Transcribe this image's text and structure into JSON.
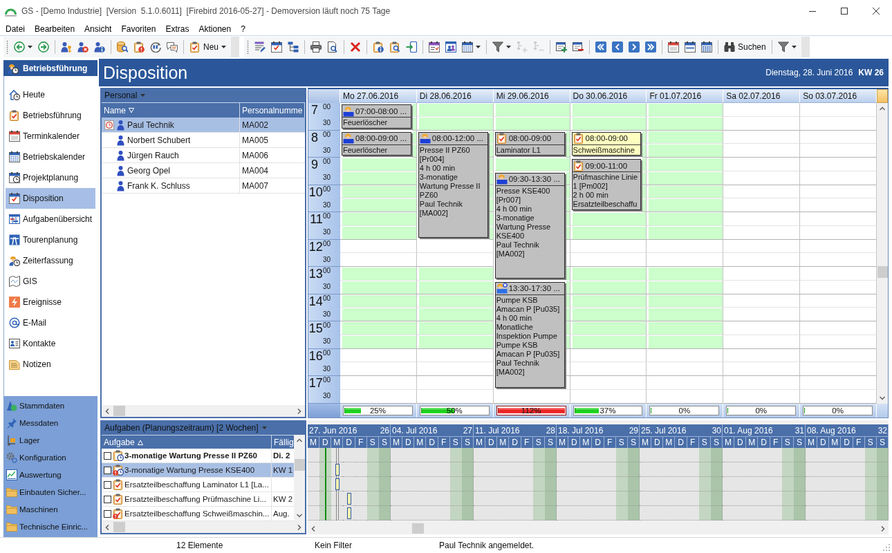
{
  "window": {
    "title": "GS - [Demo Industrie]  [Version  5.1.0.6011]  [Firebird 2016-05-27] - Demoversion läuft noch 75 Tage"
  },
  "menu": [
    "Datei",
    "Bearbeiten",
    "Ansicht",
    "Favoriten",
    "Extras",
    "Aktionen",
    "?"
  ],
  "toolbar": {
    "bands": [
      {
        "items": [
          {
            "kind": "dropdown",
            "disabled": false
          },
          {
            "kind": "button",
            "disabled": false
          },
          {
            "kind": "separator"
          },
          {
            "kind": "button",
            "disabled": false
          },
          {
            "kind": "button",
            "disabled": false
          },
          {
            "kind": "button",
            "disabled": false
          },
          {
            "kind": "separator"
          },
          {
            "kind": "button",
            "disabled": false
          },
          {
            "kind": "button",
            "disabled": false
          },
          {
            "kind": "button",
            "disabled": false
          },
          {
            "kind": "button",
            "disabled": false
          },
          {
            "kind": "separator"
          },
          {
            "kind": "dropdown",
            "label": "Neu",
            "disabled": false
          }
        ]
      },
      {
        "items": [
          {
            "kind": "button",
            "disabled": false
          },
          {
            "kind": "button",
            "disabled": false
          },
          {
            "kind": "button",
            "disabled": false
          },
          {
            "kind": "separator"
          },
          {
            "kind": "button",
            "disabled": false
          },
          {
            "kind": "button",
            "disabled": false
          },
          {
            "kind": "separator"
          },
          {
            "kind": "button",
            "disabled": false
          },
          {
            "kind": "separator"
          },
          {
            "kind": "button",
            "disabled": false
          },
          {
            "kind": "button",
            "disabled": false
          },
          {
            "kind": "button",
            "disabled": false
          },
          {
            "kind": "separator"
          },
          {
            "kind": "button",
            "disabled": false
          },
          {
            "kind": "button",
            "disabled": false
          },
          {
            "kind": "dropdown",
            "disabled": false
          },
          {
            "kind": "separator"
          },
          {
            "kind": "dropdown",
            "disabled": false
          },
          {
            "kind": "button",
            "disabled": true
          },
          {
            "kind": "button",
            "disabled": true
          },
          {
            "kind": "separator"
          },
          {
            "kind": "button",
            "disabled": false
          },
          {
            "kind": "button",
            "disabled": false
          },
          {
            "kind": "separator"
          },
          {
            "kind": "button",
            "disabled": false
          },
          {
            "kind": "button",
            "disabled": false
          },
          {
            "kind": "button",
            "disabled": false
          },
          {
            "kind": "button",
            "disabled": false
          },
          {
            "kind": "separator"
          },
          {
            "kind": "button",
            "disabled": false
          },
          {
            "kind": "button",
            "disabled": false
          },
          {
            "kind": "button",
            "disabled": false
          },
          {
            "kind": "separator"
          },
          {
            "kind": "button",
            "label": "Suchen",
            "disabled": false
          },
          {
            "kind": "separator"
          },
          {
            "kind": "dropdown",
            "disabled": false
          }
        ]
      }
    ]
  },
  "navigation": {
    "header": "Betriebsführung",
    "items": [
      {
        "label": "Heute",
        "selected": false
      },
      {
        "label": "Betriebsführung",
        "selected": false
      },
      {
        "label": "Terminkalender",
        "selected": false
      },
      {
        "label": "Betriebskalender",
        "selected": false
      },
      {
        "label": "Projektplanung",
        "selected": false
      },
      {
        "label": "Disposition",
        "selected": true
      },
      {
        "label": "Aufgabenübersicht",
        "selected": false
      },
      {
        "label": "Tourenplanung",
        "selected": false
      },
      {
        "label": "Zeiterfassung",
        "selected": false
      },
      {
        "label": "GIS",
        "selected": false
      },
      {
        "label": "Ereignisse",
        "selected": false
      },
      {
        "label": "E-Mail",
        "selected": false
      },
      {
        "label": "Kontakte",
        "selected": false
      },
      {
        "label": "Notizen",
        "selected": false
      }
    ],
    "groups": [
      {
        "label": "Stammdaten",
        "selected": false
      },
      {
        "label": "Messdaten",
        "selected": false
      },
      {
        "label": "Lager",
        "selected": false
      },
      {
        "label": "Konfiguration",
        "selected": false
      },
      {
        "label": "Auswertung",
        "selected": false
      },
      {
        "label": "Einbauten Sicher...",
        "selected": false
      },
      {
        "label": "Maschinen",
        "selected": false
      },
      {
        "label": "Technische Einric...",
        "selected": false
      }
    ]
  },
  "page": {
    "title": "Disposition",
    "date": "Dienstag, 28. Juni 2016",
    "week": "KW 26"
  },
  "personnel": {
    "title": "Personal",
    "columns": [
      {
        "label": "Name",
        "sorted": true,
        "ascending": false
      },
      {
        "label": "Personalnumme",
        "sorted": false
      }
    ],
    "rows": [
      {
        "name": "Paul Technik",
        "number": "MA002",
        "selected": true,
        "logged_in": true
      },
      {
        "name": "Norbert Schubert",
        "number": "MA005",
        "selected": false,
        "logged_in": false
      },
      {
        "name": "Jürgen Rauch",
        "number": "MA006",
        "selected": false,
        "logged_in": false
      },
      {
        "name": "Georg Opel",
        "number": "MA004",
        "selected": false,
        "logged_in": false
      },
      {
        "name": "Frank K. Schluss",
        "number": "MA007",
        "selected": false,
        "logged_in": false
      }
    ]
  },
  "calendar": {
    "time_rows": [
      {
        "hour": "7",
        "minute": "00",
        "working": true
      },
      {
        "minute": "30",
        "working": true
      },
      {
        "hour": "8",
        "minute": "00",
        "working": true
      },
      {
        "minute": "30",
        "working": true
      },
      {
        "hour": "9",
        "minute": "00",
        "working": true
      },
      {
        "minute": "30",
        "working": true
      },
      {
        "hour": "10",
        "minute": "00",
        "working": true
      },
      {
        "minute": "30",
        "working": true
      },
      {
        "hour": "11",
        "minute": "00",
        "working": true
      },
      {
        "minute": "30",
        "working": true
      },
      {
        "hour": "12",
        "minute": "00",
        "working": false
      },
      {
        "minute": "30",
        "working": false
      },
      {
        "hour": "13",
        "minute": "00",
        "working": true
      },
      {
        "minute": "30",
        "working": true
      },
      {
        "hour": "14",
        "minute": "00",
        "working": true
      },
      {
        "minute": "30",
        "working": true
      },
      {
        "hour": "15",
        "minute": "00",
        "working": true
      },
      {
        "minute": "30",
        "working": true
      },
      {
        "hour": "16",
        "minute": "00",
        "working": false
      },
      {
        "minute": "30",
        "working": false
      },
      {
        "hour": "17",
        "minute": "00",
        "working": false
      },
      {
        "minute": "30",
        "working": false
      }
    ],
    "days": [
      {
        "label": "Mo 27.06.2016",
        "working": true,
        "load": {
          "level": 0.25,
          "reading": "25%",
          "overbooked": false
        },
        "appointments": [
          {
            "kind": "maintenance",
            "time": "07:00-08:00 ...",
            "lines": [
              "Feuerlöscher"
            ],
            "selected": false
          },
          {
            "kind": "maintenance",
            "time": "08:00-09:00 ...",
            "lines": [
              "Feuerlöscher"
            ],
            "selected": false
          }
        ]
      },
      {
        "label": "Di 28.06.2016",
        "working": true,
        "load": {
          "level": 0.5,
          "reading": "50%",
          "overbooked": false
        },
        "appointments": [
          {
            "kind": "maintenance",
            "time": "08:00-12:00 ...",
            "lines": [
              "Presse II PZ60",
              "[Pr004]",
              "4 h 00 min",
              "3-monatige",
              "Wartung Presse II",
              "PZ60",
              "Paul Technik",
              "[MA002]"
            ],
            "selected": false
          }
        ]
      },
      {
        "label": "Mi 29.06.2016",
        "working": true,
        "load": {
          "level": 1,
          "reading": "112%",
          "overbooked": true
        },
        "appointments": [
          {
            "kind": "task",
            "time": "08:00-09:00",
            "lines": [
              "Laminator L1"
            ],
            "selected": false
          },
          {
            "kind": "maintenance",
            "time": "09:30-13:30 ...",
            "lines": [
              "Presse KSE400",
              "[Pr007]",
              "4 h 00 min",
              "3-monatige",
              "Wartung Presse",
              "KSE400",
              "Paul Technik",
              "[MA002]"
            ],
            "selected": false
          },
          {
            "kind": "inspection",
            "time": "13:30-17:30 ...",
            "lines": [
              "Pumpe KSB",
              "Amacan P [Pu035]",
              "4 h 00 min",
              "Monatliche",
              "Inspektion Pumpe",
              "Pumpe KSB",
              "Amacan P [Pu035]",
              "Paul Technik",
              "[MA002]"
            ],
            "selected": false
          }
        ]
      },
      {
        "label": "Do 30.06.2016",
        "working": true,
        "load": {
          "level": 0.37,
          "reading": "37%",
          "overbooked": false
        },
        "appointments": [
          {
            "kind": "task",
            "time": "08:00-09:00",
            "lines": [
              "Schweißmaschine"
            ],
            "selected": true
          },
          {
            "kind": "task",
            "time": "09:00-11:00",
            "lines": [
              "Prüfmaschine Linie",
              "1 [Pm002]",
              "2 h 00 min",
              "Ersatzteilbeschaffu"
            ],
            "selected": false
          }
        ]
      },
      {
        "label": "Fr 01.07.2016",
        "working": true,
        "load": {
          "level": 0,
          "reading": "0%",
          "overbooked": false
        }
      },
      {
        "label": "Sa 02.07.2016",
        "working": false,
        "load": {
          "level": 0,
          "reading": "0%",
          "overbooked": false
        }
      },
      {
        "label": "So 03.07.2016",
        "working": false,
        "load": {
          "level": 0,
          "reading": "0%",
          "overbooked": false
        }
      }
    ]
  },
  "tasks": {
    "title": "Aufgaben (Planungszeitraum) [2 Wochen]",
    "columns": [
      {
        "label": "Aufgabe",
        "sorted": true,
        "ascending": true
      },
      {
        "label": "Fällig",
        "sorted": false
      }
    ],
    "rows": [
      {
        "kind": "maintenance",
        "warning": false,
        "checked": false,
        "selected": false,
        "bold": true,
        "title": "3-monatige Wartung Presse II PZ60",
        "due": "Di. 2"
      },
      {
        "kind": "maintenance",
        "warning": true,
        "checked": false,
        "selected": true,
        "bold": false,
        "title": "3-monatige Wartung Presse KSE400",
        "due": "KW 1"
      },
      {
        "kind": "task",
        "warning": false,
        "checked": false,
        "selected": false,
        "bold": false,
        "title": "Ersatzteilbeschaffung Laminator L1 [La..."
      },
      {
        "kind": "task",
        "warning": false,
        "checked": false,
        "selected": false,
        "bold": false,
        "title": "Ersatzteilbeschaffung Prüfmaschine Li...",
        "due": "KW 2"
      },
      {
        "kind": "task",
        "warning": true,
        "checked": false,
        "selected": false,
        "bold": false,
        "title": "Ersatzteilbeschaffung Schweißmaschin...",
        "due": "Aug."
      }
    ]
  },
  "gantt": {
    "weeks": [
      {
        "label": "27. Jun 2016",
        "number": "26",
        "days": [
          {
            "label": "M",
            "kind": "workday"
          },
          {
            "label": "D",
            "kind": "today"
          },
          {
            "label": "M",
            "kind": "marked"
          },
          {
            "label": "D",
            "kind": "workday"
          },
          {
            "label": "F",
            "kind": "workday"
          },
          {
            "label": "S",
            "kind": "weekend"
          },
          {
            "label": "S",
            "kind": "weekend"
          }
        ],
        "rows": [
          {
            "bars": [
              false,
              false,
              false,
              false,
              false,
              false,
              false
            ]
          },
          {
            "bars": [
              false,
              false,
              true,
              false,
              false,
              false,
              false
            ]
          },
          {
            "bars": [
              false,
              false,
              true,
              false,
              false,
              false,
              false
            ]
          },
          {
            "bars": [
              false,
              false,
              false,
              true,
              false,
              false,
              false
            ]
          },
          {
            "bars": [
              false,
              false,
              false,
              true,
              false,
              false,
              false
            ]
          }
        ]
      },
      {
        "label": "04. Jul 2016",
        "number": "27",
        "days": [
          {
            "label": "M",
            "kind": "workday"
          },
          {
            "label": "D",
            "kind": "workday"
          },
          {
            "label": "M",
            "kind": "workday"
          },
          {
            "label": "D",
            "kind": "workday"
          },
          {
            "label": "F",
            "kind": "workday"
          },
          {
            "label": "S",
            "kind": "weekend"
          },
          {
            "label": "S",
            "kind": "weekend"
          }
        ]
      },
      {
        "label": "11. Jul 2016",
        "number": "28",
        "days": [
          {
            "label": "M",
            "kind": "workday"
          },
          {
            "label": "D",
            "kind": "workday"
          },
          {
            "label": "M",
            "kind": "workday"
          },
          {
            "label": "D",
            "kind": "workday"
          },
          {
            "label": "F",
            "kind": "workday"
          },
          {
            "label": "S",
            "kind": "weekend"
          },
          {
            "label": "S",
            "kind": "weekend"
          }
        ]
      },
      {
        "label": "18. Jul 2016",
        "number": "29",
        "days": [
          {
            "label": "M",
            "kind": "workday"
          },
          {
            "label": "D",
            "kind": "workday"
          },
          {
            "label": "M",
            "kind": "workday"
          },
          {
            "label": "D",
            "kind": "workday"
          },
          {
            "label": "F",
            "kind": "workday"
          },
          {
            "label": "S",
            "kind": "weekend"
          },
          {
            "label": "S",
            "kind": "weekend"
          }
        ]
      },
      {
        "label": "25. Jul 2016",
        "number": "30",
        "days": [
          {
            "label": "M",
            "kind": "workday"
          },
          {
            "label": "D",
            "kind": "workday"
          },
          {
            "label": "M",
            "kind": "workday"
          },
          {
            "label": "D",
            "kind": "workday"
          },
          {
            "label": "F",
            "kind": "workday"
          },
          {
            "label": "S",
            "kind": "weekend"
          },
          {
            "label": "S",
            "kind": "weekend"
          }
        ]
      },
      {
        "label": "01. Aug 2016",
        "number": "31",
        "days": [
          {
            "label": "M",
            "kind": "workday"
          },
          {
            "label": "D",
            "kind": "workday"
          },
          {
            "label": "M",
            "kind": "workday"
          },
          {
            "label": "D",
            "kind": "workday"
          },
          {
            "label": "F",
            "kind": "workday"
          },
          {
            "label": "S",
            "kind": "weekend"
          },
          {
            "label": "S",
            "kind": "weekend"
          }
        ]
      },
      {
        "label": "08. Aug 2016",
        "number": "32",
        "days": [
          {
            "label": "M",
            "kind": "workday"
          },
          {
            "label": "D",
            "kind": "workday"
          },
          {
            "label": "M",
            "kind": "workday"
          },
          {
            "label": "D",
            "kind": "workday"
          },
          {
            "label": "F",
            "kind": "workday"
          },
          {
            "label": "S",
            "kind": "weekend"
          },
          {
            "label": "S",
            "kind": "weekend"
          }
        ]
      }
    ]
  },
  "status_bar": [
    "12 Elemente",
    "Kein Filter",
    "Paul Technik angemeldet."
  ]
}
